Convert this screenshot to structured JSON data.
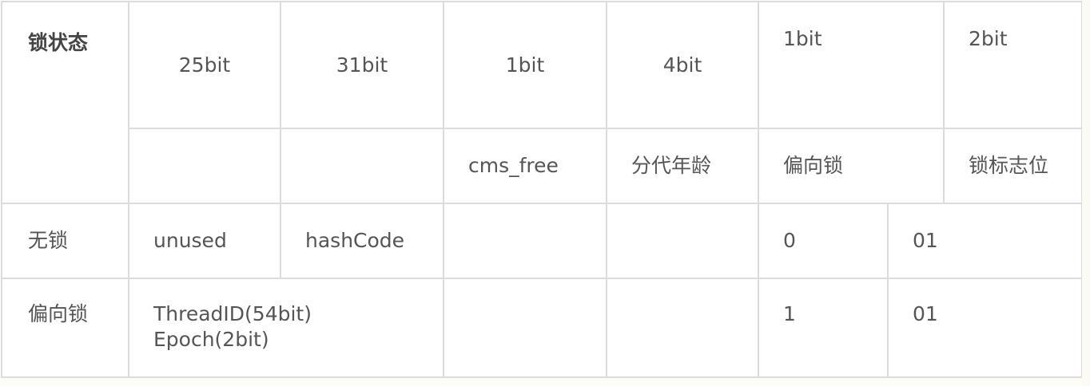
{
  "header": {
    "lock_state": "锁状态",
    "bits": [
      "25bit",
      "31bit",
      "1bit",
      "4bit",
      "1bit",
      "2bit"
    ],
    "fields": [
      "cms_free",
      "分代年龄",
      "偏向锁",
      "锁标志位"
    ]
  },
  "rows": [
    {
      "state": "无锁",
      "unused": "unused",
      "hash": "hashCode",
      "biased_bit": "0",
      "flag": "01"
    },
    {
      "state": "偏向锁",
      "thread_id": "ThreadID(54bit)",
      "epoch": "Epoch(2bit)",
      "biased_bit": "1",
      "flag": "01"
    }
  ]
}
